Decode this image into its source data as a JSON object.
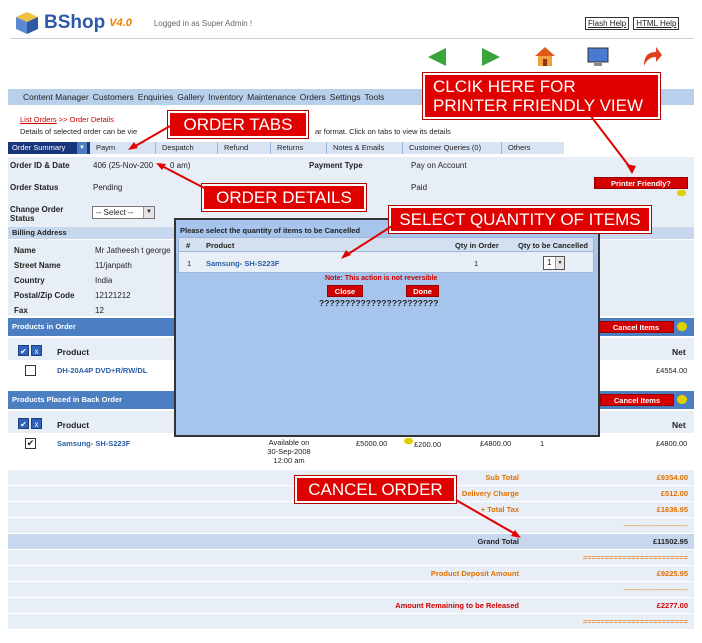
{
  "app": {
    "name": "BShop",
    "version": "V4.0",
    "logged_in": "Logged in as Super Admin !"
  },
  "help": {
    "flash": "Flash Help",
    "html": "HTML Help"
  },
  "nav": {
    "items": [
      "Content Manager",
      "Customers",
      "Enquiries",
      "Gallery",
      "Inventory",
      "Maintenance",
      "Orders",
      "Settings",
      "Tools"
    ]
  },
  "breadcrumb": {
    "list_orders": "List Orders",
    "separator": ">>",
    "current": "Order Details"
  },
  "intro": {
    "left": "Details of selected order can be vie",
    "right": "ar format. Click on tabs to view its details"
  },
  "tabs": [
    "Order Summary",
    "Paym",
    "Despatch",
    "Refund",
    "Returns",
    "Notes & Emails",
    "Customer Queries (0)",
    "Others"
  ],
  "order": {
    "id_label": "Order ID & Date",
    "id_value": "406  (25-Nov-200",
    "id_tail": "0 am)",
    "payment_type_label": "Payment Type",
    "payment_type_value": "Pay on Account",
    "status_label": "Order Status",
    "status_value": "Pending",
    "payment_status_value": "Paid",
    "change_status_label": "Change Order Status",
    "change_status_select": "-- Select --",
    "printer_button": "Printer Friendly?"
  },
  "billing": {
    "header": "Billing Address",
    "rows": [
      {
        "label": "Name",
        "value": "Mr Jatheesh t george"
      },
      {
        "label": "Street Name",
        "value": "11/janpath"
      },
      {
        "label": "Country",
        "value": "India"
      },
      {
        "label": "Postal/Zip Code",
        "value": "12121212"
      },
      {
        "label": "Fax",
        "value": "12"
      }
    ]
  },
  "products_in_order": {
    "header": "Products in Order",
    "cancel_button": "Cancel Items",
    "col_product": "Product",
    "col_net": "Net",
    "rows": [
      {
        "product": "DH-20A4P DVD+R/RW/DL",
        "net": "£4554.00"
      }
    ]
  },
  "back_order": {
    "header": "Products Placed in Back Order",
    "cancel_button": "Cancel Items",
    "col_product": "Product",
    "col_net": "Net",
    "rows": [
      {
        "product": "Samsung- SH-S223F",
        "availability": "Available on 30-Sep-2008 12:00 am",
        "price": "£5000.00",
        "discount": "£200.00",
        "total": "£4800.00",
        "qty": "1",
        "net": "£4800.00"
      }
    ]
  },
  "modal": {
    "title": "Please select the quantity of items to be Cancelled",
    "col_num": "#",
    "col_product": "Product",
    "col_qty": "Qty in Order",
    "col_cancel": "Qty to be Cancelled",
    "row": {
      "num": "1",
      "product": "Samsung- SH-S223F",
      "qty": "1",
      "cancel_qty": "1"
    },
    "note": "Note: This action is not reversible",
    "close_button": "Close",
    "done_button": "Done",
    "garbage": "???????????????????????"
  },
  "totals": [
    {
      "label": "Sub Total",
      "value": "£9354.00",
      "style": "orange"
    },
    {
      "label": "Delivery Charge",
      "value": "£512.00",
      "style": "orange"
    },
    {
      "label": "+ Total Tax",
      "value": "£1636.95",
      "style": "orange"
    },
    {
      "label": "",
      "value": "--------------------------",
      "style": "orange"
    },
    {
      "label": "Grand Total",
      "value": "£11502.95",
      "style": "grand"
    },
    {
      "label": "",
      "value": "========================",
      "style": "orange"
    },
    {
      "label": "Product Deposit Amount",
      "value": "£9225.95",
      "style": "orange"
    },
    {
      "label": "",
      "value": "--------------------------",
      "style": "orange"
    },
    {
      "label": "Amount Remaining to be Released",
      "value": "£2277.00",
      "style": "red"
    },
    {
      "label": "",
      "value": "========================",
      "style": "orange"
    }
  ],
  "callouts": {
    "printer": "CLCIK HERE FOR PRINTER FRIENDLY VIEW",
    "tabs": "ORDER TABS",
    "details": "ORDER DETAILS",
    "quantity": "SELECT QUANTITY OF ITEMS",
    "cancel": "CANCEL ORDER"
  },
  "icons": [
    "cube-logo-icon",
    "back-arrow-icon",
    "forward-arrow-icon",
    "home-icon",
    "monitor-icon",
    "logout-arrow-icon",
    "dropdown-arrow-icon",
    "checkbox-icon",
    "help-icon"
  ],
  "colors": {
    "brand_blue": "#4c7fc2",
    "nav_bg": "#b9d0ec",
    "row_bg": "#e8eef6",
    "callout_red": "#e00000",
    "modal_bg": "#a6c4ec",
    "total_orange": "#e07000"
  }
}
